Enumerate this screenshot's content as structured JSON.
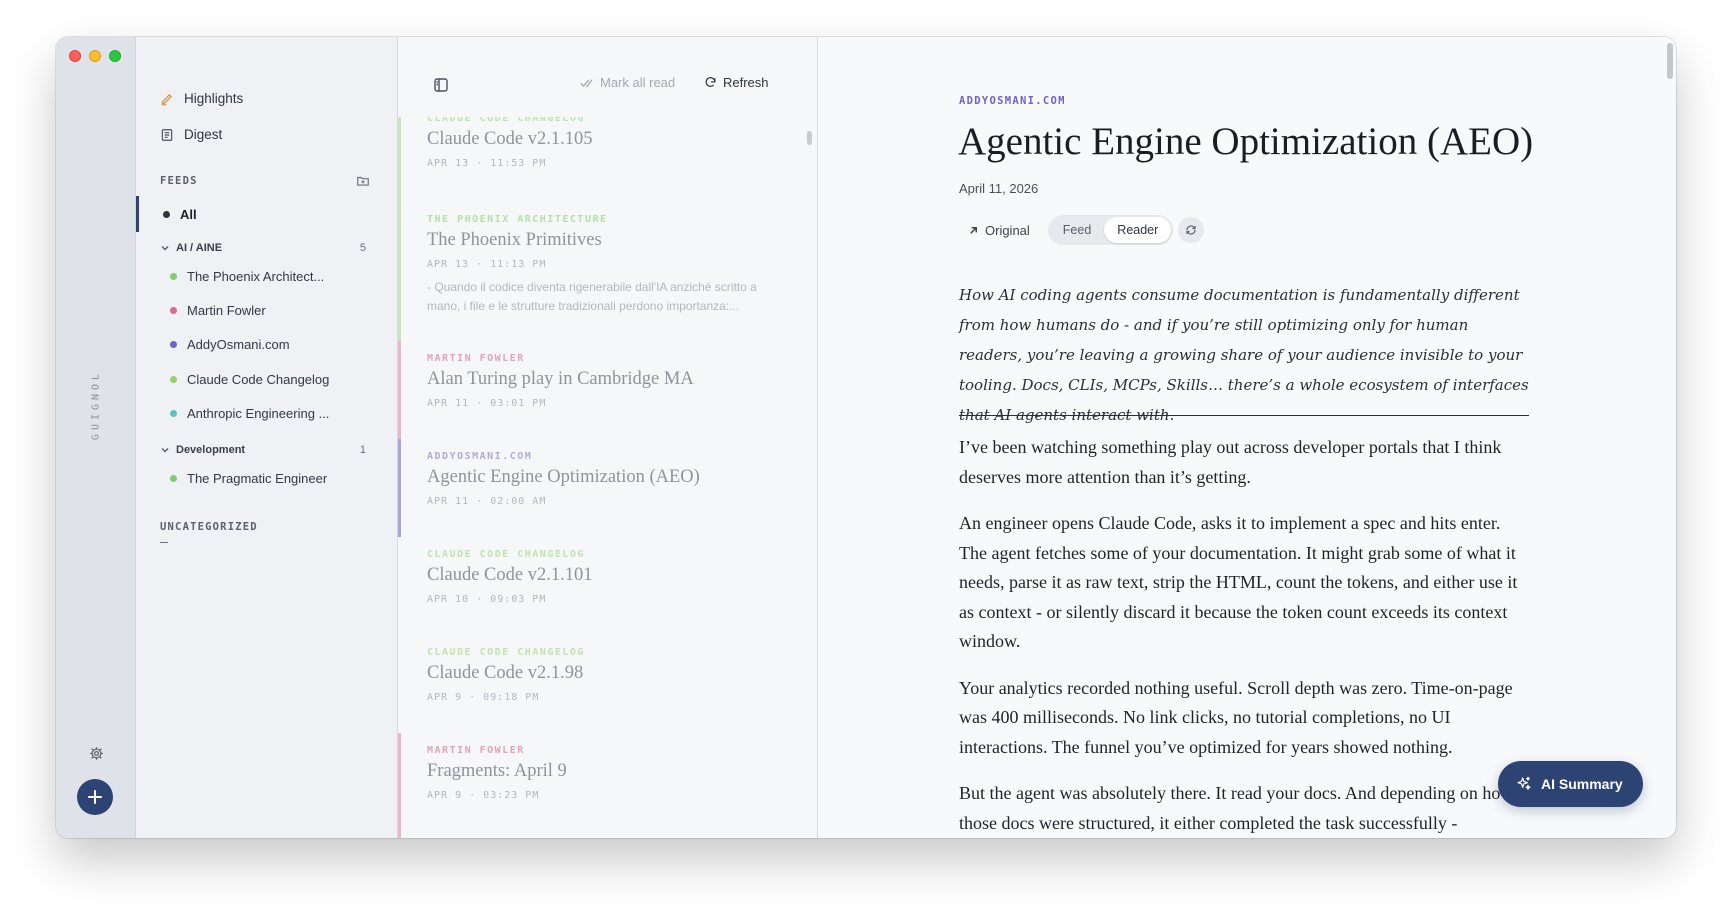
{
  "app": {
    "brand": "GUIGNOL"
  },
  "colors": {
    "accent": "#2c4373",
    "phoenix": "#7ccf6a",
    "fowler": "#d96b86",
    "addy": "#6f63c9",
    "claude": "#90d36a",
    "anthropic": "#5bc3c0",
    "pragmatic": "#7ccf6a"
  },
  "sidebar": {
    "highlights": "Highlights",
    "digest": "Digest",
    "feeds_label": "FEEDS",
    "all_label": "All",
    "groups": [
      {
        "name": "AI / AINE",
        "count": "5",
        "feeds": [
          {
            "name": "The Phoenix Architect...",
            "color": "#7ccf6a"
          },
          {
            "name": "Martin Fowler",
            "color": "#d96b86"
          },
          {
            "name": "AddyOsmani.com",
            "color": "#6f63c9"
          },
          {
            "name": "Claude Code Changelog",
            "color": "#90d36a"
          },
          {
            "name": "Anthropic Engineering ...",
            "color": "#5bc3c0"
          }
        ]
      },
      {
        "name": "Development",
        "count": "1",
        "feeds": [
          {
            "name": "The Pragmatic Engineer",
            "color": "#7ccf6a"
          }
        ]
      }
    ],
    "uncategorized_label": "UNCATEGORIZED"
  },
  "list": {
    "mark_all_read": "Mark all read",
    "refresh": "Refresh",
    "articles": [
      {
        "source": "CLAUDE CODE CHANGELOG",
        "title": "Claude Code v2.1.105",
        "date": "APR 13",
        "time": "11:53 PM",
        "excerpt": "",
        "color": "#90d36a",
        "src_color": "#bfe3ac"
      },
      {
        "source": "THE PHOENIX ARCHITECTURE",
        "title": "The Phoenix Primitives",
        "date": "APR 13",
        "time": "11:13 PM",
        "excerpt": "- Quando il codice diventa rigenerabile dall'IA anziché scritto a mano, i file e le strutture tradizionali perdono importanza:...",
        "color": "#b6dfa8",
        "src_color": "#b6dfa8"
      },
      {
        "source": "MARTIN FOWLER",
        "title": "Alan Turing play in Cambridge MA",
        "date": "APR 11",
        "time": "03:01 PM",
        "excerpt": "",
        "color": "#ebb7c4",
        "src_color": "#e3a5b6"
      },
      {
        "source": "ADDYOSMANI.COM",
        "title": "Agentic Engine Optimization (AEO)",
        "date": "APR 11",
        "time": "02:00 AM",
        "excerpt": "",
        "color": "#a9a3e4",
        "src_color": "#b0aadb"
      },
      {
        "source": "CLAUDE CODE CHANGELOG",
        "title": "Claude Code v2.1.101",
        "date": "APR 10",
        "time": "09:03 PM",
        "excerpt": "",
        "color": "#c7e8b6",
        "src_color": "#bfe3ac"
      },
      {
        "source": "CLAUDE CODE CHANGELOG",
        "title": "Claude Code v2.1.98",
        "date": "APR 9",
        "time": "09:18 PM",
        "excerpt": "",
        "color": "#c7e8b6",
        "src_color": "#bfe3ac"
      },
      {
        "source": "MARTIN FOWLER",
        "title": "Fragments: April 9",
        "date": "APR 9",
        "time": "03:23 PM",
        "excerpt": "",
        "color": "#ebb7c4",
        "src_color": "#e3a5b6"
      }
    ]
  },
  "reader": {
    "source": "ADDYOSMANI.COM",
    "title": "Agentic Engine Optimization (AEO)",
    "date": "April 11, 2026",
    "original": "Original",
    "feed": "Feed",
    "reader_mode": "Reader",
    "lead": "How AI coding agents consume documentation is fundamentally different from how humans do - and if you’re still optimizing only for human readers, you’re leaving a growing share of your audience invisible to your tooling. Docs, CLIs, MCPs, Skills… there’s a whole ecosystem of interfaces that AI agents interact with.",
    "paragraphs": [
      "I’ve been watching something play out across developer portals that I think deserves more attention than it’s getting.",
      "An engineer opens Claude Code, asks it to implement a spec and hits enter. The agent fetches some of your documentation. It might grab some of what it needs, parse it as raw text, strip the HTML, count the tokens, and either use it as context - or silently discard it because the token count exceeds its context window.",
      "Your analytics recorded nothing useful. Scroll depth was zero. Time-on-page was 400 milliseconds. No link clicks, no tutorial completions, no UI interactions. The funnel you’ve optimized for years showed nothing.",
      "But the agent was absolutely there. It read your docs. And depending on how those docs were structured, it either completed the task successfully -"
    ],
    "ai_summary": "AI Summary"
  }
}
